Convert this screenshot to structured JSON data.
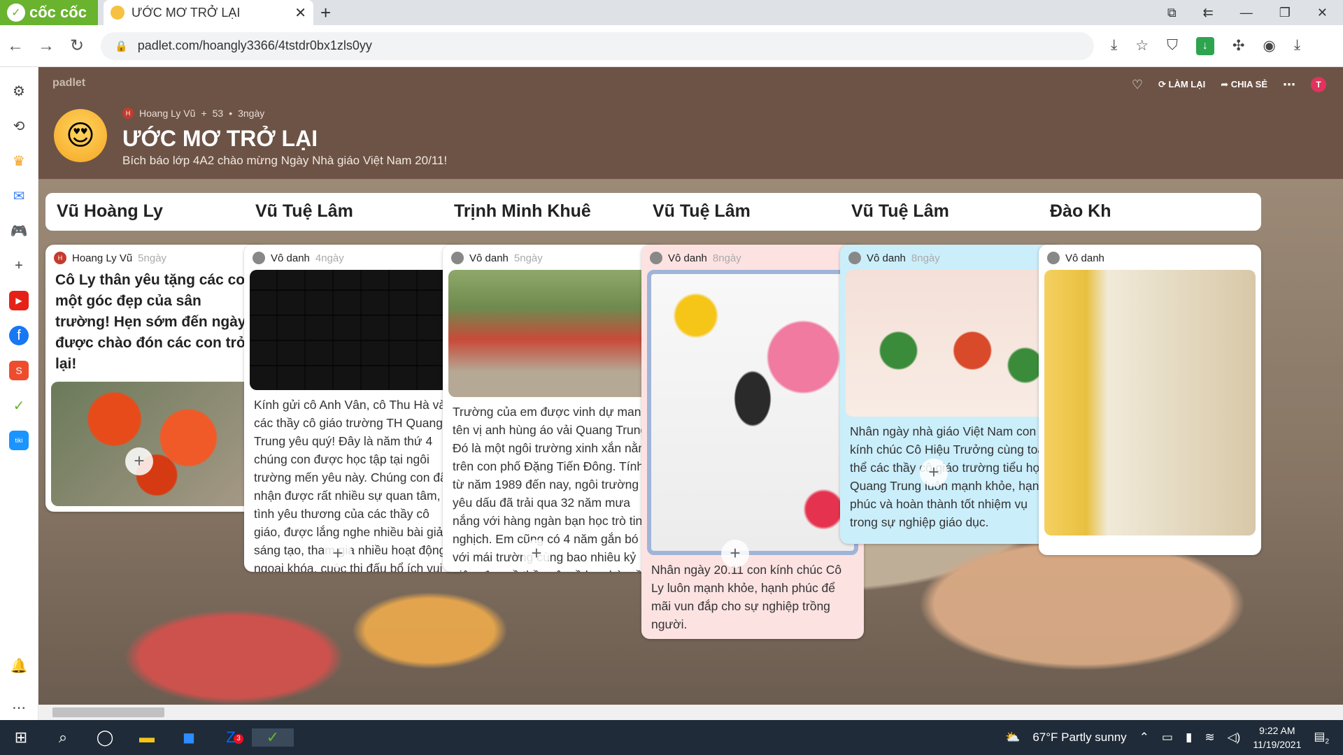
{
  "browser": {
    "brand": "cốc cốc",
    "tab_title": "ƯỚC MƠ TRỞ LẠI",
    "url": "padlet.com/hoangly3366/4tstdr0bx1zls0yy"
  },
  "header": {
    "logo": "padlet",
    "remake": "LÀM LẠI",
    "share": "CHIA SẺ",
    "avatar_initial": "T",
    "author_initial": "H",
    "author": "Hoang Ly Vũ",
    "plus": "+",
    "likes": "53",
    "sep": "•",
    "age": "3ngày",
    "title": "ƯỚC MƠ TRỞ LẠI",
    "subtitle": "Bích báo lớp 4A2 chào mừng Ngày Nhà giáo Việt Nam 20/11!"
  },
  "columns": [
    {
      "heading": "Vũ Hoàng Ly",
      "author_initial": "H",
      "author": "Hoang Ly Vũ",
      "time": "5ngày",
      "headline": "Cô Ly thân yêu tặng các con một góc đẹp của sân trường! Hẹn sớm đến ngày được chào đón các con trở lại!"
    },
    {
      "heading": "Vũ Tuệ Lâm",
      "author": "Vô danh",
      "time": "4ngày",
      "text": "Kính gửi cô Anh Vân, cô Thu Hà và các thầy cô giáo trường TH Quang Trung yêu quý! Đây là năm thứ 4 chúng con được học tập tại ngôi trường mến yêu này. Chúng con đã nhận được rất nhiều sự quan tâm, tình yêu thương của các thầy cô giáo, được lắng nghe nhiều bài giảng sáng tạo, tham gia nhiều hoạt động ngoại khóa, cuộc thi đấu bổ ích vui quên lối về do nhà trường tổ chức. Hôm nay, chúng con đang sống và học tập trong lúc cả nước căng"
    },
    {
      "heading": "Trịnh Minh Khuê",
      "author": "Vô danh",
      "time": "5ngày",
      "text": "Trường của em được vinh dự mang tên vị anh hùng áo vải Quang Trung. Đó là một ngôi trường xinh xắn nằm trên con phố Đặng Tiến Đông. Tính từ năm 1989 đến nay, ngôi trường yêu dấu đã trải qua 32 năm mưa nắng với hàng ngàn bạn học trò tinh nghịch. Em cũng có 4 năm gắn bó với mái trường cùng bao nhiêu kỷ niệm đẹp về thầy cô, về bạn bè, về những giờ ra chơi ồn ã, náo nhiệt... Em nhớ nhất là lần em"
    },
    {
      "heading": "Vũ Tuệ Lâm",
      "author": "Vô danh",
      "time": "8ngày",
      "text": "Nhân ngày 20.11 con kính chúc Cô Ly luôn mạnh khỏe, hạnh phúc để mãi vun đắp cho sự nghiệp trồng người."
    },
    {
      "heading": "Vũ Tuệ Lâm",
      "author": "Vô danh",
      "time": "8ngày",
      "text": "Nhân ngày nhà giáo Việt Nam con kính chúc Cô Hiệu Trưởng cùng toàn thể các thầy cô giáo trường tiểu học Quang Trung luôn mạnh khỏe, hạnh phúc và hoàn thành tốt nhiệm vụ trong sự nghiệp giáo dục."
    },
    {
      "heading": "Đào Kh",
      "author": "Vô danh"
    }
  ],
  "taskbar": {
    "weather": "67°F  Partly sunny",
    "time": "9:22 AM",
    "date": "11/19/2021",
    "zalo_badge": "3",
    "notif_count": "2"
  },
  "colors": {
    "header_bg": "#6d5346",
    "pink_card": "#fde2e2",
    "blue_card": "#cbeefb",
    "coccoc_green": "#69b32f"
  }
}
